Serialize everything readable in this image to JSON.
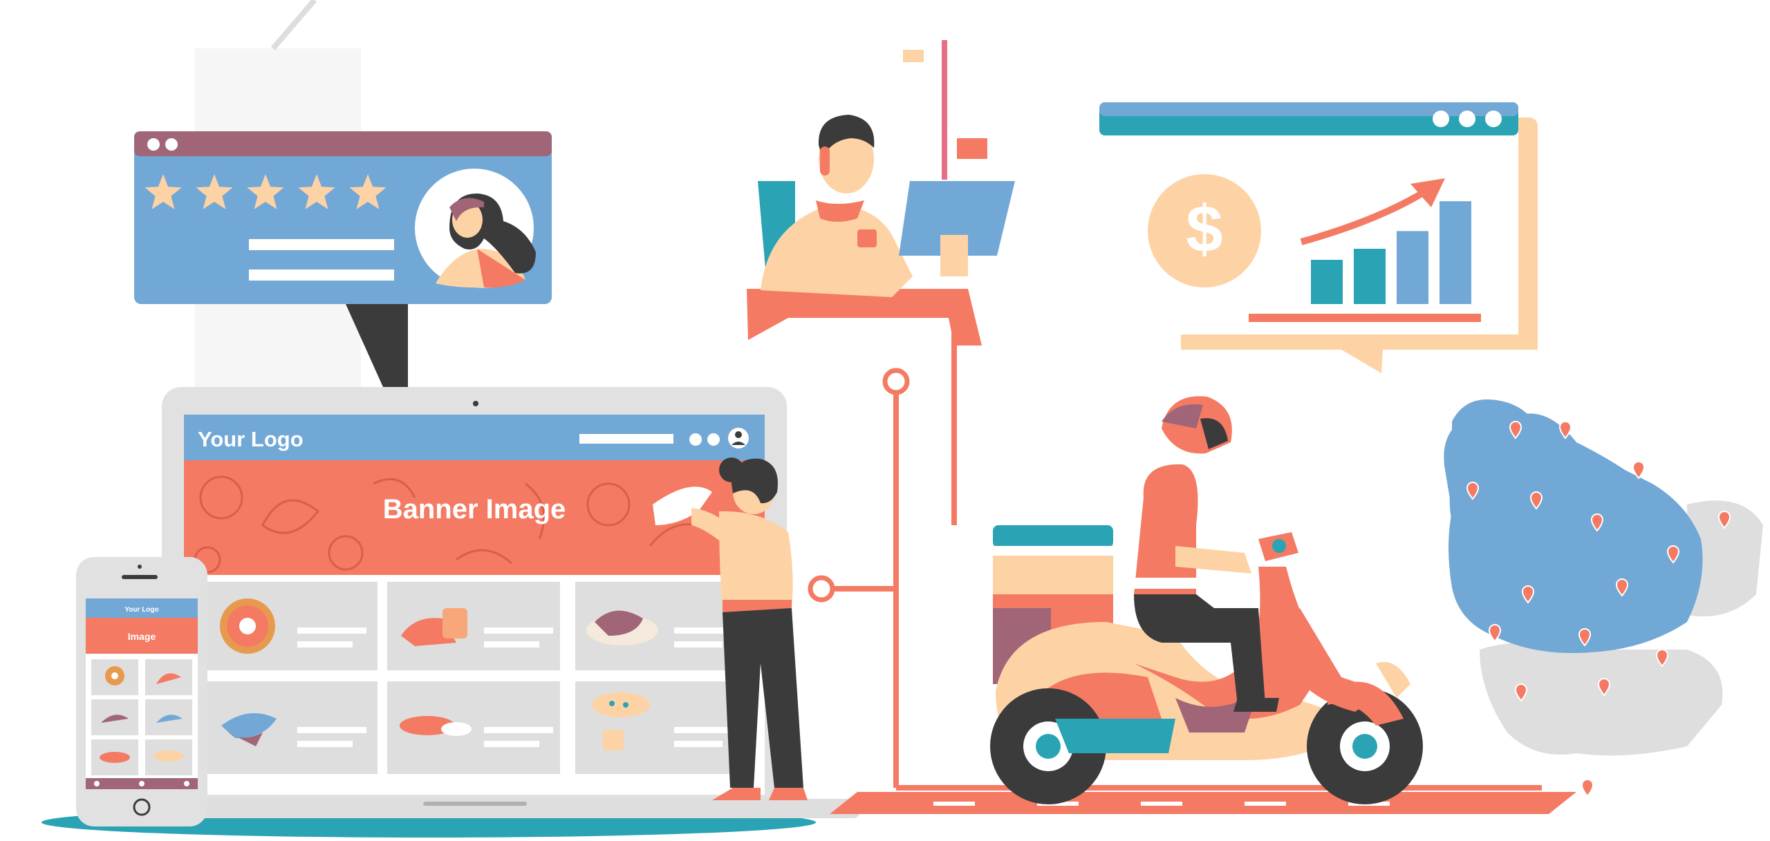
{
  "colors": {
    "blue": "#72a8d6",
    "teal": "#2aa3b5",
    "coral": "#f47a63",
    "peach": "#fdd3a6",
    "dark": "#3b3b3b",
    "mauve": "#a06678",
    "grey": "#dedede"
  },
  "laptop_site": {
    "logo_text": "Your Logo",
    "banner_text": "Banner Image"
  },
  "phone_site": {
    "logo_text": "Your Logo",
    "banner_text": "Image"
  },
  "review_card": {
    "rating": 5,
    "max_rating": 5
  },
  "analytics_card": {
    "currency_symbol": "$",
    "bar_levels": [
      0.4,
      0.5,
      0.66,
      0.93
    ]
  },
  "icons": [
    "star-icon",
    "avatar-icon",
    "dollar-icon",
    "trend-arrow-icon",
    "map-pin-icon",
    "user-icon"
  ]
}
